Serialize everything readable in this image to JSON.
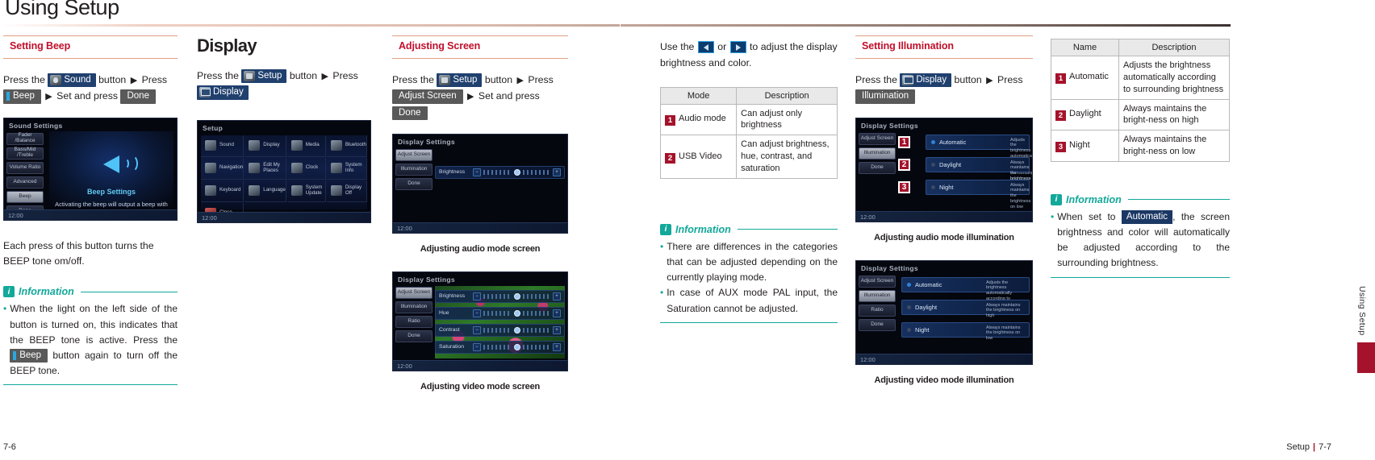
{
  "page": {
    "title": "Using Setup",
    "folio_left": "7-6",
    "folio_right_chapter": "Setup",
    "folio_right_sep": "|",
    "folio_right_page": "7-7",
    "edge_label": "Using Setup"
  },
  "col1": {
    "heading": "Setting Beep",
    "instruction": {
      "press_the": "Press the",
      "btn_sound": "Sound",
      "button": "button",
      "press": "Press",
      "btn_beep": "Beep",
      "set_and_press": "Set and press",
      "btn_done": "Done"
    },
    "device": {
      "title": "Sound Settings",
      "clock": "12:00",
      "side_buttons": [
        "Fader /Balance",
        "Bass/Mid /Treble",
        "Volume Ratio",
        "Advanced",
        "Beep",
        "Done"
      ],
      "art_title": "Beep Settings",
      "art_desc": "Activating the beep will output a beep with each touch of the display."
    },
    "body_text": "Each press of this button turns the BEEP tone om/off.",
    "information": {
      "title": "Information",
      "items": [
        {
          "pre": "When the light on the left side of the button is turned on, this indicates that the BEEP tone is active. Press the",
          "button": "Beep",
          "post": "button again to turn off the BEEP tone."
        }
      ]
    }
  },
  "col2": {
    "heading": "Display",
    "instruction": {
      "press_the": "Press the",
      "btn_setup": "Setup",
      "button": "button",
      "press": "Press",
      "btn_display": "Display"
    },
    "device": {
      "title": "Setup",
      "clock": "12:00",
      "grid": [
        "Sound",
        "Display",
        "Media",
        "Bluetooth",
        "Navigation",
        "Edit My Places",
        "Clock",
        "System Info",
        "Keyboard",
        "Language",
        "System Update",
        "Display Off",
        "Close"
      ]
    }
  },
  "col3": {
    "heading": "Adjusting Screen",
    "instruction": {
      "press_the": "Press the",
      "btn_setup": "Setup",
      "button": "button",
      "press": "Press",
      "btn_adjust_screen": "Adjust Screen",
      "set_and_press": "Set and press",
      "btn_done": "Done"
    },
    "device_audio": {
      "title": "Display Settings",
      "clock": "12:00",
      "side_buttons": [
        "Adjust Screen",
        "Illumination",
        "Done"
      ],
      "rows": [
        {
          "label": "Brightness"
        }
      ],
      "caption": "Adjusting audio mode screen"
    },
    "device_video": {
      "title": "Display Settings",
      "clock": "12:00",
      "side_buttons": [
        "Adjust Screen",
        "Illumination",
        "Ratio",
        "Done"
      ],
      "rows": [
        {
          "label": "Brightness"
        },
        {
          "label": "Hue"
        },
        {
          "label": "Contrast"
        },
        {
          "label": "Saturation"
        }
      ],
      "caption": "Adjusting video mode screen"
    }
  },
  "col4": {
    "instruction": {
      "use_the": "Use the",
      "or": "or",
      "tail": "to adjust the display brightness and color."
    },
    "table": {
      "headers": [
        "Mode",
        "Description"
      ],
      "rows": [
        {
          "num": "1",
          "name": "Audio mode",
          "description": "Can adjust only brightness"
        },
        {
          "num": "2",
          "name": "USB Video",
          "description": "Can adjust brightness, hue, contrast, and saturation"
        }
      ]
    },
    "information": {
      "title": "Information",
      "items": [
        {
          "pre": "There are differences in the categories that can be adjusted depending on the currently playing mode.",
          "button": "",
          "post": ""
        },
        {
          "pre": "In case of AUX mode PAL input, the Saturation cannot be adjusted.",
          "button": "",
          "post": ""
        }
      ]
    }
  },
  "col5": {
    "heading": "Setting Illumination",
    "instruction": {
      "press_the": "Press the",
      "btn_display": "Display",
      "button": "button",
      "press": "Press",
      "btn_illumination": "Illumination"
    },
    "device_audio": {
      "title": "Display Settings",
      "clock": "12:00",
      "side_buttons": [
        "Adjust Screen",
        "Illumination",
        "Done"
      ],
      "rows": [
        {
          "num": "1",
          "name": "Automatic",
          "desc": "Adjusts the brightness automatically according to surrounding brightness"
        },
        {
          "num": "2",
          "name": "Daylight",
          "desc": "Always maintains the brightness on high"
        },
        {
          "num": "3",
          "name": "Night",
          "desc": "Always maintains the brightness on low"
        }
      ],
      "caption": "Adjusting audio mode illumination"
    },
    "device_video": {
      "title": "Display Settings",
      "clock": "12:00",
      "side_buttons": [
        "Adjust Screen",
        "Illumination",
        "Ratio",
        "Done"
      ],
      "rows": [
        {
          "num": "",
          "name": "Automatic",
          "desc": "Adjusts the brightness automatically according to surrounding brightness"
        },
        {
          "num": "",
          "name": "Daylight",
          "desc": "Always maintains the brightness on high"
        },
        {
          "num": "",
          "name": "Night",
          "desc": "Always maintains the brightness on low"
        }
      ],
      "caption": "Adjusting video mode illumination"
    }
  },
  "col6": {
    "table": {
      "headers": [
        "Name",
        "Description"
      ],
      "rows": [
        {
          "num": "1",
          "name": "Automatic",
          "description": "Adjusts the brightness automatically according to surrounding brightness"
        },
        {
          "num": "2",
          "name": "Daylight",
          "description": "Always maintains the bright-ness on high"
        },
        {
          "num": "3",
          "name": "Night",
          "description": "Always maintains the bright-ness on low"
        }
      ]
    },
    "information": {
      "title": "Information",
      "items": [
        {
          "pre": "When set to",
          "button": "Automatic",
          "post": ", the screen brightness and color will automatically be adjusted according to the surrounding brightness."
        }
      ]
    }
  },
  "colors": {
    "accent_red": "#c10f2b",
    "tab_red": "#a5122b",
    "info_teal": "#12a89a",
    "btn_blue": "#20406e",
    "btn_grey": "#595959"
  }
}
